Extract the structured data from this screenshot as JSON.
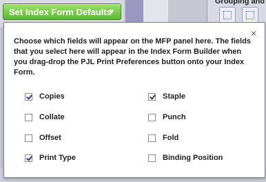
{
  "toolbar": {
    "dropdown_label": "Set Index Form Defaults",
    "right_group_label": "Grouping and"
  },
  "popup": {
    "close_glyph": "×",
    "description": "Choose which fields will appear on the MFP panel here. The fields that you select here will appear in the Index Form Builder when you drag-drop the PJL Print Preferences button onto your Index Form.",
    "options_left": [
      {
        "label": "Copies",
        "checked": true
      },
      {
        "label": "Collate",
        "checked": false
      },
      {
        "label": "Offset",
        "checked": false
      },
      {
        "label": "Print Type",
        "checked": true
      }
    ],
    "options_right": [
      {
        "label": "Staple",
        "checked": true
      },
      {
        "label": "Punch",
        "checked": false
      },
      {
        "label": "Fold",
        "checked": false
      },
      {
        "label": "Binding Position",
        "checked": false
      }
    ]
  },
  "colors": {
    "button_green": "#6cc93e",
    "check_blue": "#2a3a7c"
  }
}
